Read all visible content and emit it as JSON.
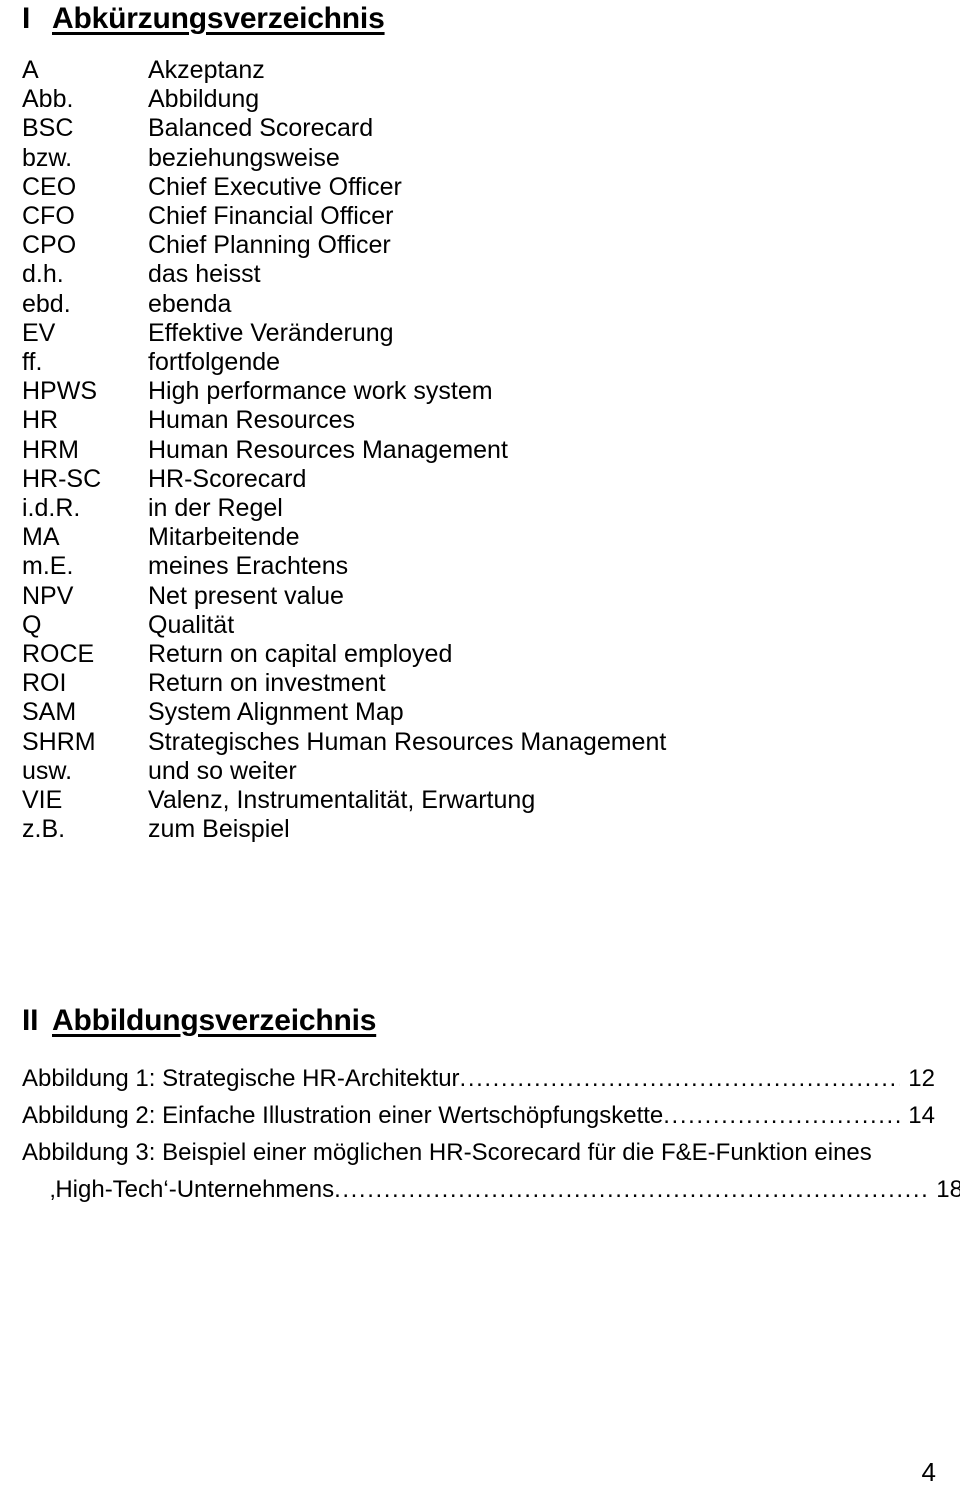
{
  "document": {
    "page_number": "4"
  },
  "sections": {
    "abbreviations": {
      "number": "I",
      "title": "Abkürzungsverzeichnis",
      "entries": [
        {
          "term": "A",
          "definition": "Akzeptanz"
        },
        {
          "term": "Abb.",
          "definition": "Abbildung"
        },
        {
          "term": "BSC",
          "definition": "Balanced Scorecard"
        },
        {
          "term": "bzw.",
          "definition": "beziehungsweise"
        },
        {
          "term": "CEO",
          "definition": "Chief Executive Officer"
        },
        {
          "term": "CFO",
          "definition": "Chief Financial Officer"
        },
        {
          "term": "CPO",
          "definition": "Chief Planning Officer"
        },
        {
          "term": "d.h.",
          "definition": "das heisst"
        },
        {
          "term": "ebd.",
          "definition": "ebenda"
        },
        {
          "term": "EV",
          "definition": "Effektive Veränderung"
        },
        {
          "term": "ff.",
          "definition": "fortfolgende"
        },
        {
          "term": "HPWS",
          "definition": "High performance work system"
        },
        {
          "term": "HR",
          "definition": "Human Resources"
        },
        {
          "term": "HRM",
          "definition": "Human Resources Management"
        },
        {
          "term": "HR-SC",
          "definition": "HR-Scorecard"
        },
        {
          "term": "i.d.R.",
          "definition": "in der Regel"
        },
        {
          "term": "MA",
          "definition": "Mitarbeitende"
        },
        {
          "term": "m.E.",
          "definition": "meines Erachtens"
        },
        {
          "term": "NPV",
          "definition": "Net present value"
        },
        {
          "term": "Q",
          "definition": "Qualität"
        },
        {
          "term": "ROCE",
          "definition": "Return on capital employed"
        },
        {
          "term": "ROI",
          "definition": "Return on investment"
        },
        {
          "term": "SAM",
          "definition": "System Alignment Map"
        },
        {
          "term": "SHRM",
          "definition": "Strategisches Human Resources Management"
        },
        {
          "term": "usw.",
          "definition": "und so weiter"
        },
        {
          "term": "VIE",
          "definition": "Valenz, Instrumentalität, Erwartung"
        },
        {
          "term": "z.B.",
          "definition": "zum Beispiel"
        }
      ]
    },
    "figures": {
      "number": "II",
      "title": "Abbildungsverzeichnis",
      "entries": [
        {
          "line1": "Abbildung 1: Strategische HR-Architektur ",
          "line2": null,
          "page": "12"
        },
        {
          "line1": "Abbildung 2: Einfache Illustration einer Wertschöpfungskette",
          "line2": null,
          "page": "14"
        },
        {
          "line1": "Abbildung 3: Beispiel einer möglichen HR-Scorecard für die F&E-Funktion eines",
          "line2": "‚High-Tech‘-Unternehmens",
          "page": "18"
        }
      ],
      "leader_char": "."
    }
  }
}
